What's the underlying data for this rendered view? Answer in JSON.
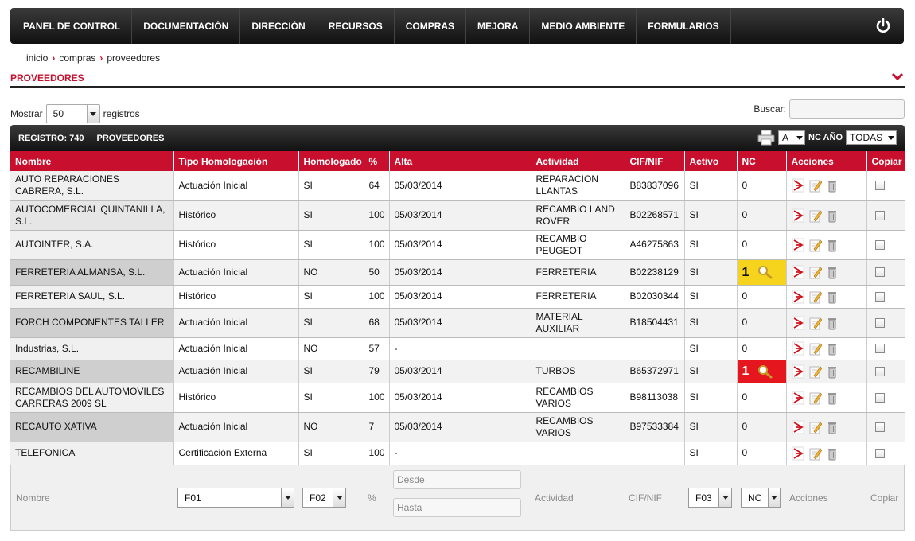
{
  "nav": {
    "items": [
      "PANEL DE CONTROL",
      "DOCUMENTACIÓN",
      "DIRECCIÓN",
      "RECURSOS",
      "COMPRAS",
      "MEJORA",
      "MEDIO AMBIENTE",
      "FORMULARIOS"
    ],
    "power_icon": "power-icon"
  },
  "breadcrumb": {
    "items": [
      "inicio",
      "compras",
      "proveedores"
    ]
  },
  "section": {
    "title": "PROVEEDORES"
  },
  "controls": {
    "mostrar_label": "Mostrar",
    "mostrar_value": "50",
    "registros_label": "registros",
    "buscar_label": "Buscar:"
  },
  "tablebar": {
    "registro": "REGISTRO: 740",
    "title": "PROVEEDORES",
    "letter_value": "A",
    "nc_year_label": "NC AÑO",
    "year_value": "TODAS"
  },
  "columns": [
    "Nombre",
    "Tipo Homologación",
    "Homologado",
    "%",
    "Alta",
    "Actividad",
    "CIF/NIF",
    "Activo",
    "NC",
    "Acciones",
    "Copiar"
  ],
  "rows": [
    {
      "nombre": "AUTO REPARACIONES CABRERA, S.L.",
      "tipo": "Actuación Inicial",
      "homologado": "SI",
      "pct": "64",
      "alta": "05/03/2014",
      "actividad": "REPARACION LLANTAS",
      "cif": "B83837096",
      "activo": "SI",
      "nc": "0",
      "nc_state": "normal"
    },
    {
      "nombre": "AUTOCOMERCIAL QUINTANILLA, S.L.",
      "tipo": "Histórico",
      "homologado": "SI",
      "pct": "100",
      "alta": "05/03/2014",
      "actividad": "RECAMBIO LAND ROVER",
      "cif": "B02268571",
      "activo": "SI",
      "nc": "0",
      "nc_state": "normal"
    },
    {
      "nombre": "AUTOINTER, S.A.",
      "tipo": "Histórico",
      "homologado": "SI",
      "pct": "100",
      "alta": "05/03/2014",
      "actividad": "RECAMBIO PEUGEOT",
      "cif": "A46275863",
      "activo": "SI",
      "nc": "0",
      "nc_state": "normal"
    },
    {
      "nombre": "FERRETERIA ALMANSA, S.L.",
      "tipo": "Actuación Inicial",
      "homologado": "NO",
      "pct": "50",
      "alta": "05/03/2014",
      "actividad": "FERRETERIA",
      "cif": "B02238129",
      "activo": "SI",
      "nc": "1",
      "nc_state": "yellow"
    },
    {
      "nombre": "FERRETERIA SAUL, S.L.",
      "tipo": "Histórico",
      "homologado": "SI",
      "pct": "100",
      "alta": "05/03/2014",
      "actividad": "FERRETERIA",
      "cif": "B02030344",
      "activo": "SI",
      "nc": "0",
      "nc_state": "normal"
    },
    {
      "nombre": "FORCH COMPONENTES TALLER",
      "tipo": "Actuación Inicial",
      "homologado": "SI",
      "pct": "68",
      "alta": "05/03/2014",
      "actividad": "MATERIAL AUXILIAR",
      "cif": "B18504431",
      "activo": "SI",
      "nc": "0",
      "nc_state": "normal"
    },
    {
      "nombre": "Industrias, S.L.",
      "tipo": "Actuación Inicial",
      "homologado": "NO",
      "pct": "57",
      "alta": "-",
      "actividad": "",
      "cif": "",
      "activo": "SI",
      "nc": "0",
      "nc_state": "normal"
    },
    {
      "nombre": "RECAMBILINE",
      "tipo": "Actuación Inicial",
      "homologado": "SI",
      "pct": "79",
      "alta": "05/03/2014",
      "actividad": "TURBOS",
      "cif": "B65372971",
      "activo": "SI",
      "nc": "1",
      "nc_state": "red"
    },
    {
      "nombre": "RECAMBIOS DEL AUTOMOVILES CARRERAS 2009 SL",
      "tipo": "Histórico",
      "homologado": "SI",
      "pct": "100",
      "alta": "05/03/2014",
      "actividad": "RECAMBIOS VARIOS",
      "cif": "B98113038",
      "activo": "SI",
      "nc": "0",
      "nc_state": "normal"
    },
    {
      "nombre": "RECAUTO XATIVA",
      "tipo": "Actuación Inicial",
      "homologado": "NO",
      "pct": "7",
      "alta": "05/03/2014",
      "actividad": "RECAMBIOS VARIOS",
      "cif": "B97533384",
      "activo": "SI",
      "nc": "0",
      "nc_state": "normal"
    },
    {
      "nombre": "TELEFONICA",
      "tipo": "Certificación Externa",
      "homologado": "SI",
      "pct": "100",
      "alta": "-",
      "actividad": "",
      "cif": "",
      "activo": "SI",
      "nc": "0",
      "nc_state": "normal"
    }
  ],
  "footer": {
    "nombre": "Nombre",
    "f01": "F01",
    "f02": "F02",
    "pct": "%",
    "desde": "Desde",
    "hasta": "Hasta",
    "actividad": "Actividad",
    "cif": "CIF/NIF",
    "f03": "F03",
    "nc": "NC",
    "acciones": "Acciones",
    "copiar": "Copiar"
  },
  "colors": {
    "accent": "#c8102e",
    "nav_bg": "#1a1a1a",
    "nc_yellow": "#f6d31c",
    "nc_red": "#e5161e"
  }
}
